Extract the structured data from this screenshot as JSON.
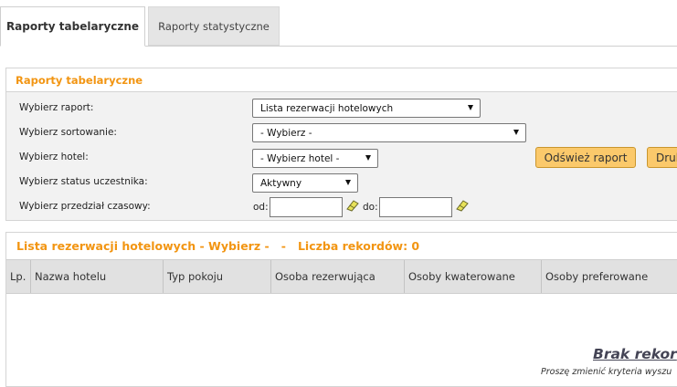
{
  "tabs": [
    {
      "label": "Raporty tabelaryczne",
      "active": true
    },
    {
      "label": "Raporty statystyczne",
      "active": false
    }
  ],
  "filters": {
    "title": "Raporty tabelaryczne",
    "report_label": "Wybierz raport:",
    "report_value": "Lista rezerwacji hotelowych",
    "sort_label": "Wybierz sortowanie:",
    "sort_value": "- Wybierz -",
    "hotel_label": "Wybierz hotel:",
    "hotel_value": "- Wybierz hotel -",
    "status_label": "Wybierz status uczestnika:",
    "status_value": "Aktywny",
    "range_label": "Wybierz przedział czasowy:",
    "from_label": "od:",
    "to_label": "do:",
    "from_value": "",
    "to_value": "",
    "refresh_button": "Odśwież raport",
    "print_button": "Druk"
  },
  "results": {
    "title": "Lista rezerwacji hotelowych - Wybierz -   -   Liczba rekordów: 0",
    "columns": [
      "Lp.",
      "Nazwa hotelu",
      "Typ pokoju",
      "Osoba rezerwująca",
      "Osoby kwaterowane",
      "Osoby preferowane"
    ],
    "empty_title": "Brak rekor",
    "empty_subtitle": "Proszę zmienić kryteria wyszu"
  },
  "colors": {
    "accent": "#f29512",
    "button": "#fbc96b"
  }
}
